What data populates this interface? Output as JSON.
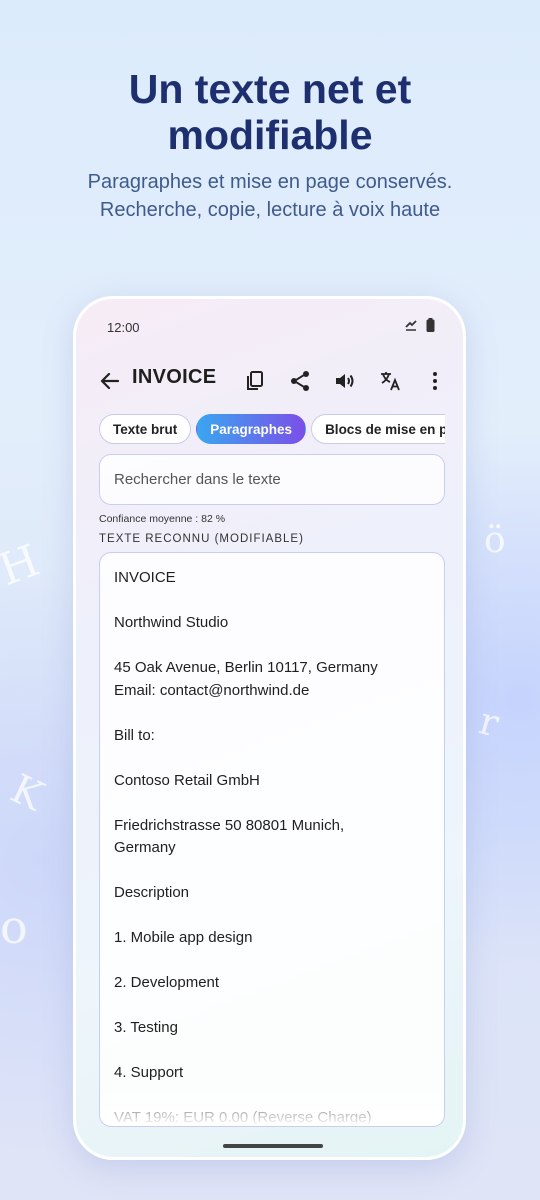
{
  "hero": {
    "title": "Un texte net et modifiable",
    "subtitle": "Paragraphes et mise en page conservés. Recherche, copie, lecture à voix haute"
  },
  "status": {
    "time": "12:00"
  },
  "toolbar": {
    "title": "INVOICE",
    "icons": [
      "back-arrow-icon",
      "copy-icon",
      "share-icon",
      "volume-icon",
      "translate-icon",
      "more-vert-icon"
    ]
  },
  "tabs": [
    {
      "label": "Texte brut",
      "selected": false
    },
    {
      "label": "Paragraphes",
      "selected": true
    },
    {
      "label": "Blocs de mise en page",
      "selected": false
    }
  ],
  "search": {
    "placeholder": "Rechercher dans le texte",
    "value": ""
  },
  "confidence": "Confiance moyenne : 82 %",
  "section_label": "TEXTE RECONNU (MODIFIABLE)",
  "recognized_text": [
    "INVOICE",
    "",
    "Northwind Studio",
    "",
    "45 Oak Avenue, Berlin 10117, Germany",
    "Email: contact@northwind.de",
    "",
    "Bill to:",
    "",
    "Contoso Retail GmbH",
    "",
    "Friedrichstrasse 50 80801 Munich,",
    "Germany",
    "",
    "Description",
    "",
    "1. Mobile app design",
    "",
    "2. Development",
    "",
    "3. Testing",
    "",
    "4. Support",
    "",
    "VAT 19%: EUR 0.00 (Reverse Charge)"
  ],
  "colors": {
    "hero_title": "#1d2f6e",
    "hero_subtitle": "#3f5a8c",
    "chip_gradient_start": "#3aa6f0",
    "chip_gradient_end": "#7b4fe8"
  }
}
